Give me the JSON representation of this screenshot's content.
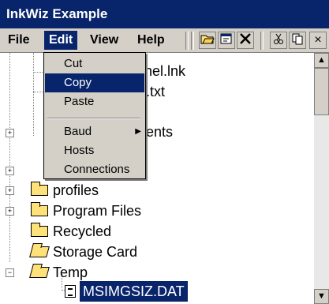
{
  "window": {
    "title": "InkWiz Example"
  },
  "menubar": {
    "file": "File",
    "edit": "Edit",
    "view": "View",
    "help": "Help"
  },
  "toolbar": {
    "open_icon": "open-folder-icon",
    "properties_icon": "properties-icon",
    "delete_icon": "delete-icon",
    "cut_icon": "cut-icon",
    "copy_icon": "copy-icon",
    "close_label": "×"
  },
  "edit_menu": {
    "items": [
      {
        "label": "Cut"
      },
      {
        "label": "Copy"
      },
      {
        "label": "Paste"
      },
      {
        "label": "Baud"
      },
      {
        "label": "Hosts"
      },
      {
        "label": "Connections"
      }
    ]
  },
  "tree": {
    "partial_1": "hel.lnk",
    "partial_2": ".txt",
    "partial_3": "ents",
    "items": [
      {
        "label": "profiles"
      },
      {
        "label": "Program Files"
      },
      {
        "label": "Recycled"
      },
      {
        "label": "Storage Card"
      },
      {
        "label": "Temp"
      },
      {
        "label": "MSIMGSIZ.DAT"
      }
    ]
  },
  "colors": {
    "titlebar": "#08246b",
    "chrome": "#d4d0c8",
    "selection": "#08246b"
  }
}
